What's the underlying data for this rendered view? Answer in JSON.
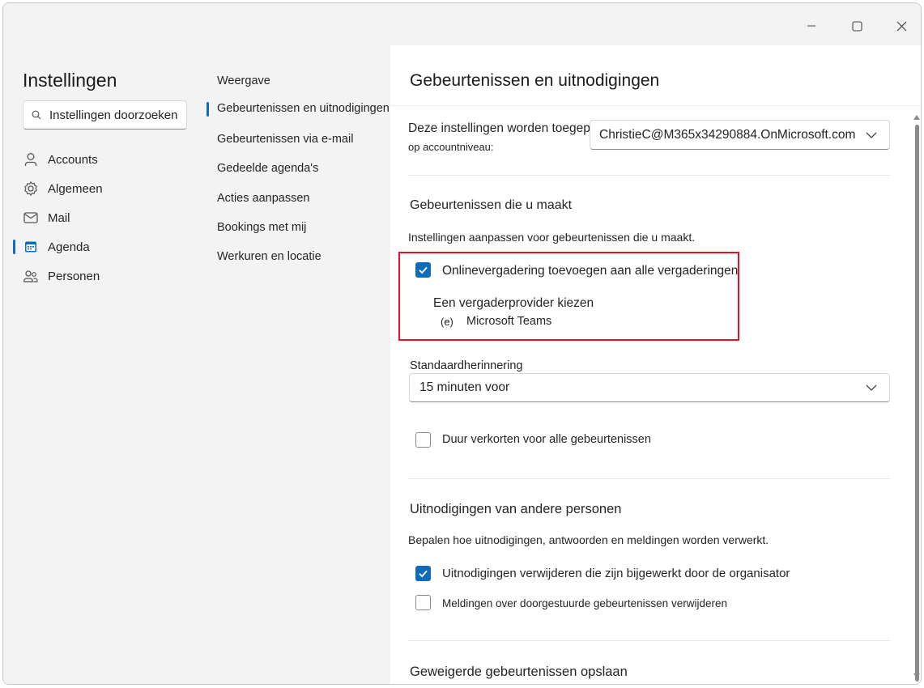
{
  "window": {
    "controls": {
      "minimize": "minimize-icon",
      "maximize": "maximize-icon",
      "close": "close-icon"
    }
  },
  "nav": {
    "title": "Instellingen",
    "search_placeholder": "Instellingen doorzoeken",
    "items": [
      {
        "label": "Accounts",
        "icon": "person-icon"
      },
      {
        "label": "Algemeen",
        "icon": "gear-icon"
      },
      {
        "label": "Mail",
        "icon": "mail-icon"
      },
      {
        "label": "Agenda",
        "icon": "calendar-icon",
        "selected": true
      },
      {
        "label": "Personen",
        "icon": "people-icon"
      }
    ]
  },
  "subnav": {
    "items": [
      {
        "label": "Weergave"
      },
      {
        "label": "Gebeurtenissen en uitnodigingen",
        "selected": true
      },
      {
        "label": "Gebeurtenissen via e-mail"
      },
      {
        "label": "Gedeelde agenda's"
      },
      {
        "label": "Acties aanpassen"
      },
      {
        "label": "Bookings met mij"
      },
      {
        "label": "Werkuren en locatie"
      }
    ]
  },
  "content": {
    "title": "Gebeurtenissen en uitnodigingen",
    "account_label_line1": "Deze instellingen worden toegepast",
    "account_label_line2": "op accountniveau:",
    "account_value": "ChristieC@M365x34290884.OnMicrosoft.com",
    "section1": {
      "heading": "Gebeurtenissen die u maakt",
      "description": "Instellingen aanpassen voor gebeurtenissen die u maakt.",
      "online_meeting_label": "Onlinevergadering toevoegen aan alle vergaderingen",
      "online_meeting_checked": true,
      "provider_label": "Een vergaderprovider kiezen",
      "provider_icon_text": "(e)",
      "provider_value": "Microsoft Teams",
      "reminder_label": "Standaardherinnering",
      "reminder_value": "15 minuten voor",
      "shorten_label": "Duur verkorten voor alle gebeurtenissen",
      "shorten_checked": false
    },
    "section2": {
      "heading": "Uitnodigingen van andere personen",
      "description": "Bepalen hoe uitnodigingen, antwoorden en meldingen worden verwerkt.",
      "delete_updated_label": "Uitnodigingen verwijderen die zijn bijgewerkt door de organisator",
      "delete_updated_checked": true,
      "delete_forwarded_label": "Meldingen over doorgestuurde gebeurtenissen verwijderen",
      "delete_forwarded_checked": false
    },
    "section3": {
      "heading": "Geweigerde gebeurtenissen opslaan"
    }
  },
  "colors": {
    "accent": "#0f6cbd",
    "highlight_border": "#e81123",
    "background": "#f3f3f3"
  }
}
